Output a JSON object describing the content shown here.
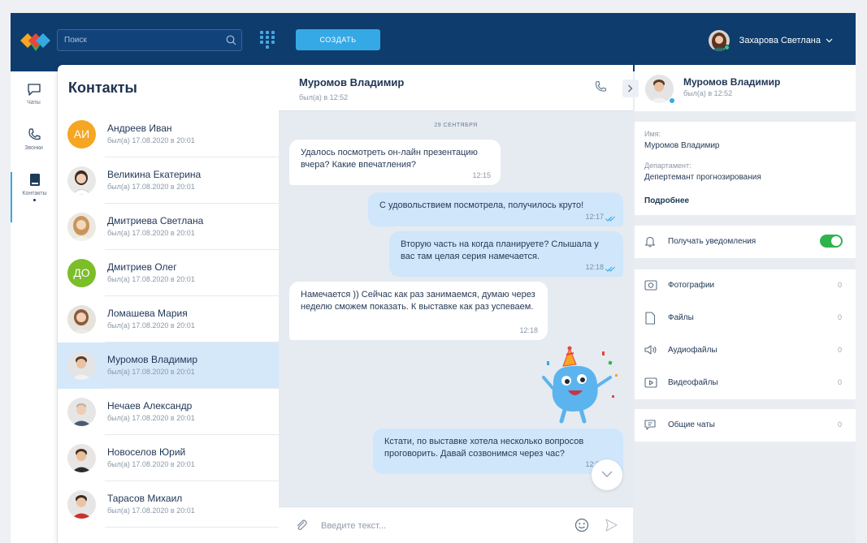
{
  "topbar": {
    "search_placeholder": "Поиск",
    "create_label": "СОЗДАТЬ",
    "user_name": "Захарова Светлана"
  },
  "rail": {
    "items": [
      {
        "label": "Чаты",
        "icon": "chat-bubble-icon"
      },
      {
        "label": "Звонки",
        "icon": "phone-icon"
      },
      {
        "label": "Контакты",
        "icon": "contacts-book-icon",
        "active": true
      }
    ]
  },
  "contacts": {
    "title": "Контакты",
    "items": [
      {
        "name": "Андреев Иван",
        "last_seen": "был(а) 17.08.2020 в 20:01",
        "initials": "АИ",
        "color": "#f5a623"
      },
      {
        "name": "Великина Екатерина",
        "last_seen": "был(а) 17.08.2020 в 20:01"
      },
      {
        "name": "Дмитриева Светлана",
        "last_seen": "был(а) 17.08.2020 в 20:01"
      },
      {
        "name": "Дмитриев Олег",
        "last_seen": "был(а) 17.08.2020 в 20:01",
        "initials": "ДО",
        "color": "#7cbd2a"
      },
      {
        "name": "Ломашева Мария",
        "last_seen": "был(а) 17.08.2020 в 20:01"
      },
      {
        "name": "Муромов Владимир",
        "last_seen": "был(а) 17.08.2020 в 20:01",
        "selected": true
      },
      {
        "name": "Нечаев Александр",
        "last_seen": "был(а) 17.08.2020 в 20:01"
      },
      {
        "name": "Новоселов Юрий",
        "last_seen": "был(а) 17.08.2020 в 20:01"
      },
      {
        "name": "Тарасов Михаил",
        "last_seen": "был(а) 17.08.2020 в 20:01"
      }
    ]
  },
  "chat": {
    "name": "Муромов Владимир",
    "last_seen": "был(а) в 12:52",
    "date": "29 СЕНТЯБРЯ",
    "messages": [
      {
        "dir": "in",
        "text": "Удалось посмотреть он-лайн презентацию вчера? Какие впечатления?",
        "time": "12:15"
      },
      {
        "dir": "out",
        "text": "С удовольствием посмотрела, получилось круто!",
        "time": "12:17"
      },
      {
        "dir": "out",
        "text": "Вторую часть на когда планируете? Слышала у вас там целая серия намечается.",
        "time": "12:18"
      },
      {
        "dir": "in",
        "text": "Намечается )) Сейчас как раз занимаемся, думаю через неделю сможем показать. К выставке как раз успеваем.",
        "time": "12:18"
      },
      {
        "dir": "out",
        "text": "Кстати, по выставке хотела несколько вопросов проговорить. Давай созвонимся через час?",
        "time": "12:20"
      }
    ],
    "input_placeholder": "Введите текст..."
  },
  "info": {
    "name": "Муромов Владимир",
    "last_seen": "был(а) в 12:52",
    "name_label": "Имя:",
    "name_value": "Муромов Владимир",
    "dept_label": "Департамент:",
    "dept_value": "Депертемант прогнозирования",
    "more": "Подробнее",
    "notify_label": "Получать уведомления",
    "media": [
      {
        "label": "Фотографии",
        "count": "0"
      },
      {
        "label": "Файлы",
        "count": "0"
      },
      {
        "label": "Аудиофайлы",
        "count": "0"
      },
      {
        "label": "Видеофайлы",
        "count": "0"
      }
    ],
    "common_chats": {
      "label": "Общие чаты",
      "count": "0"
    }
  },
  "colors": {
    "topbar": "#0e3c6d",
    "accent": "#35a8e6",
    "toggle_on": "#2fb34c"
  }
}
